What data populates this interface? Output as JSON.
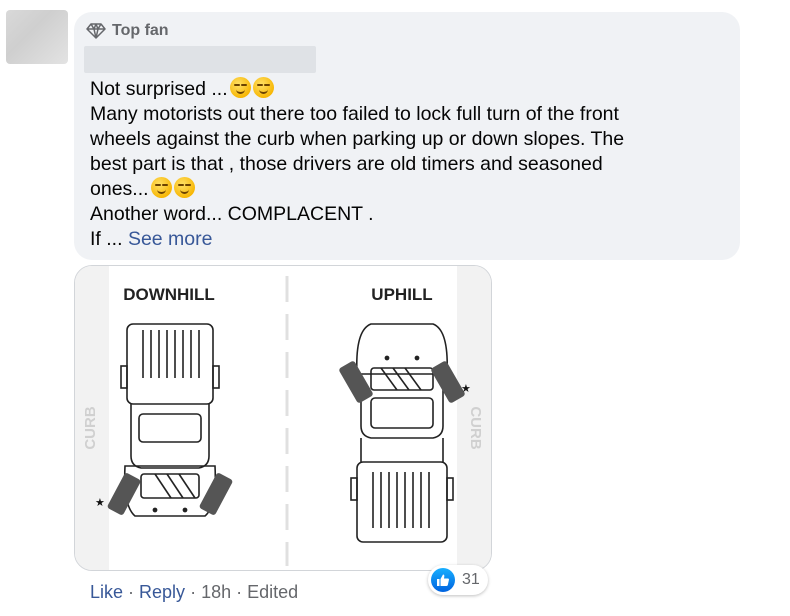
{
  "badge": {
    "label": "Top fan",
    "icon": "diamond-icon"
  },
  "comment": {
    "lines": [
      "Not surprised ...",
      "Many motorists out there too failed to lock full turn of the front",
      "wheels against the curb when parking up or down slopes. The",
      "best part is that , those drivers are old timers and seasoned",
      "ones...",
      "Another word... COMPLACENT .",
      "If ..."
    ],
    "see_more": "See more"
  },
  "image": {
    "left_title": "DOWNHILL",
    "right_title": "UPHILL",
    "curb_label": "CURB",
    "marker": "★"
  },
  "footer": {
    "like": "Like",
    "reply": "Reply",
    "time": "18h",
    "edited": "Edited",
    "separator": "·"
  },
  "reactions": {
    "count": "31",
    "icon": "like-icon",
    "color": "#1877f2"
  }
}
